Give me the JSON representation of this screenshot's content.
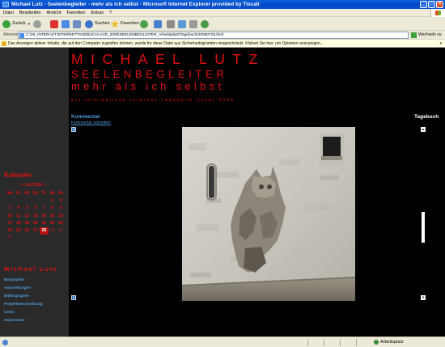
{
  "window": {
    "title": "Michael Lutz - Seelenbegleiter - mehr als ich selbst - Microsoft Internet Explorer provided by Tiscali"
  },
  "menu": [
    "Datei",
    "Bearbeiten",
    "Ansicht",
    "Favoriten",
    "Extras",
    "?"
  ],
  "toolbar": {
    "back_label": "Zurück",
    "search_label": "Suchen",
    "favorites_label": "Favoriten"
  },
  "address": {
    "label": "Adresse",
    "url": "C:\\26_INTERAKT.INTERNETTAGEBUCH-LIVE_2005\\SEELENBEGLEITER_Arbeitsplatz\\Tagebuch\\20060728.html",
    "go_label": "Wechseln zu"
  },
  "infobar": {
    "text": "Das Anzeigen aktiver Inhalte, die auf den Computer zugreifen können, wurde für diese Datei aus Sicherheitsgründen eingeschränkt. Klicken Sie hier, um Optionen anzuzeigen...",
    "close": "x"
  },
  "site": {
    "title": "MICHAEL LUTZ",
    "subtitle": "SEELENBEGLEITER",
    "motto": "mehr als ich selbst",
    "tagline": "ein interaktives Internet-Tagebuch (live) 2006"
  },
  "content": {
    "kommentar_heading": "Kommentar",
    "kommentar_link": "Kommentar schreiben",
    "tagebuch_heading": "Tagebuch"
  },
  "calendar": {
    "heading": "Kalender",
    "month": "< Juli 2006 >",
    "weekdays": [
      "Mo",
      "Di",
      "Mi",
      "Do",
      "Fr",
      "Sa",
      "So"
    ],
    "weeks": [
      [
        "",
        "",
        "",
        "",
        "",
        "1",
        "2"
      ],
      [
        "3",
        "4",
        "5",
        "6",
        "7",
        "8",
        "9"
      ],
      [
        "10",
        "11",
        "12",
        "13",
        "14",
        "15",
        "16"
      ],
      [
        "17",
        "18",
        "19",
        "20",
        "21",
        "22",
        "23"
      ],
      [
        "24",
        "25",
        "26",
        "27",
        "28",
        "29",
        "30"
      ],
      [
        "31",
        "",
        "",
        "",
        "",
        "",
        ""
      ]
    ],
    "selected": "28"
  },
  "nav": {
    "heading": "Michael Lutz",
    "items": [
      "Biographie",
      "Ausstellungen",
      "Bibliographie",
      "Projektbeschreibung",
      "Links",
      "Impressum"
    ]
  },
  "status": {
    "zone": "Arbeitsplatz"
  },
  "colors": {
    "accent_red": "#e01010",
    "link_blue": "#4f9bd6",
    "page_bg": "#000000",
    "sidebar_bg": "#2a2a2a"
  }
}
